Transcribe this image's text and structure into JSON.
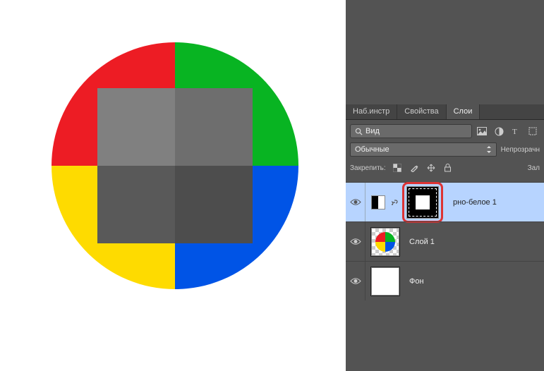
{
  "tabs": {
    "navigator": "Наб.инстр",
    "properties": "Свойства",
    "layers": "Слои"
  },
  "search": {
    "label": "Вид"
  },
  "blend": {
    "mode": "Обычные",
    "opacity_label": "Непрозрачн"
  },
  "lock": {
    "label": "Закрепить:",
    "fill_label": "Зал"
  },
  "layers": {
    "adj": {
      "name": "рно-белое 1"
    },
    "l1": {
      "name": "Слой 1"
    },
    "bg": {
      "name": "Фон"
    }
  },
  "colors": {
    "red": "#ED1C24",
    "green": "#00A651",
    "yellow": "#FFDE00",
    "blue": "#0054E6",
    "g1": "#808080",
    "g2": "#6E6E6E",
    "g3": "#595959",
    "g4": "#4D4D4D"
  }
}
